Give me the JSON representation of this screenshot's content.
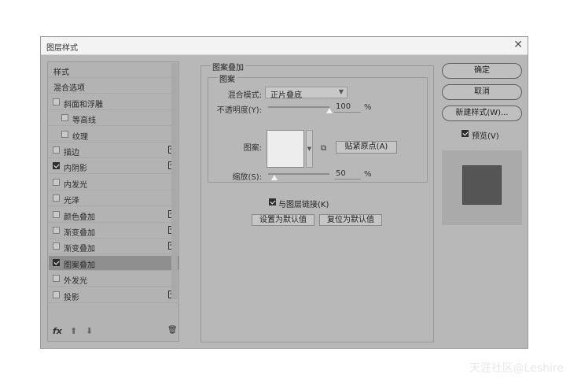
{
  "dialog": {
    "title": "图层样式",
    "close_glyph": "✕"
  },
  "sidebar": {
    "items": [
      {
        "label": "样式",
        "checkbox": false,
        "checked": false,
        "plus": false,
        "selected": false,
        "indent": 0
      },
      {
        "label": "混合选项",
        "checkbox": false,
        "checked": false,
        "plus": false,
        "selected": false,
        "indent": 0
      },
      {
        "label": "斜面和浮雕",
        "checkbox": true,
        "checked": false,
        "plus": false,
        "selected": false,
        "indent": 0
      },
      {
        "label": "等高线",
        "checkbox": true,
        "checked": false,
        "plus": false,
        "selected": false,
        "indent": 1
      },
      {
        "label": "纹理",
        "checkbox": true,
        "checked": false,
        "plus": false,
        "selected": false,
        "indent": 1
      },
      {
        "label": "描边",
        "checkbox": true,
        "checked": false,
        "plus": true,
        "selected": false,
        "indent": 0
      },
      {
        "label": "内阴影",
        "checkbox": true,
        "checked": true,
        "plus": true,
        "selected": false,
        "indent": 0
      },
      {
        "label": "内发光",
        "checkbox": true,
        "checked": false,
        "plus": false,
        "selected": false,
        "indent": 0
      },
      {
        "label": "光泽",
        "checkbox": true,
        "checked": false,
        "plus": false,
        "selected": false,
        "indent": 0
      },
      {
        "label": "颜色叠加",
        "checkbox": true,
        "checked": false,
        "plus": true,
        "selected": false,
        "indent": 0
      },
      {
        "label": "渐变叠加",
        "checkbox": true,
        "checked": false,
        "plus": true,
        "selected": false,
        "indent": 0
      },
      {
        "label": "渐变叠加",
        "checkbox": true,
        "checked": false,
        "plus": true,
        "selected": false,
        "indent": 0
      },
      {
        "label": "图案叠加",
        "checkbox": true,
        "checked": true,
        "plus": false,
        "selected": true,
        "indent": 0
      },
      {
        "label": "外发光",
        "checkbox": true,
        "checked": false,
        "plus": false,
        "selected": false,
        "indent": 0
      },
      {
        "label": "投影",
        "checkbox": true,
        "checked": false,
        "plus": true,
        "selected": false,
        "indent": 0
      }
    ],
    "plus_glyph": "+",
    "bottom": {
      "fx": "fx",
      "up": "⬆",
      "down": "⬇",
      "trash": "🗑"
    }
  },
  "main": {
    "group_title": "图案叠加",
    "sub_title": "图案",
    "blend_mode_label": "混合模式:",
    "blend_mode_value": "正片叠底",
    "opacity_label": "不透明度(Y):",
    "opacity_value": "100",
    "opacity_fraction": 1.0,
    "pattern_label": "图案:",
    "snap_button": "贴紧原点(A)",
    "scale_label": "缩放(S):",
    "scale_value": "50",
    "scale_fraction": 0.1,
    "percent": "%",
    "link_label": "与图层链接(K)",
    "link_checked": true,
    "set_default": "设置为默认值",
    "reset_default": "复位为默认值"
  },
  "right": {
    "ok": "确定",
    "cancel": "取消",
    "new_style": "新建样式(W)...",
    "preview_label": "预览(V)",
    "preview_checked": true,
    "preview_color": "#555555"
  },
  "watermark": "天涯社区@Leshire"
}
